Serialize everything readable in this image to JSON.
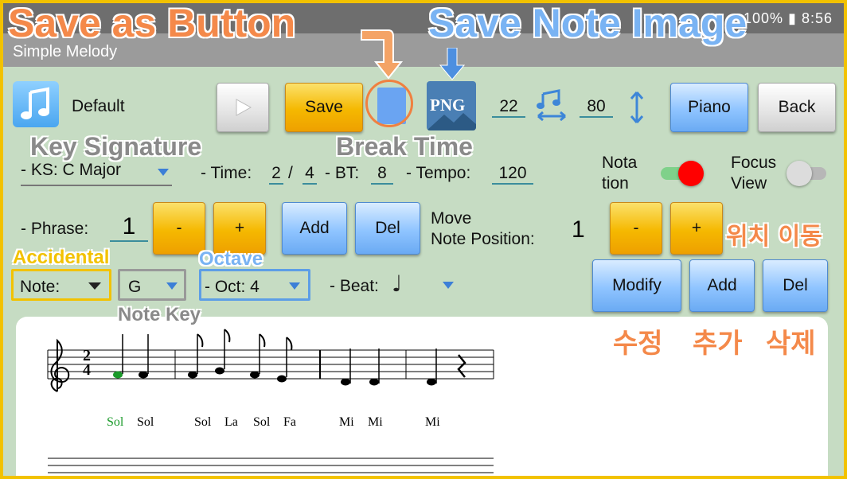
{
  "status_bar": {
    "right_text": "100% ▮ 8:56"
  },
  "app": {
    "title": "Simple Melody"
  },
  "toolbar": {
    "preset_icon": "music-note-icon",
    "preset_label": "Default",
    "play_icon": "play-icon",
    "save_label": "Save",
    "png_label": "PNG",
    "break_value": "22",
    "tempo_icon": "beamed-notes-icon",
    "tempo_value": "80",
    "piano_label": "Piano",
    "back_label": "Back"
  },
  "row2": {
    "ks_value": "- KS: C Major",
    "time_label": "- Time:",
    "time_num": "2",
    "time_sep": "/",
    "time_den": "4",
    "bt_label": "- BT:",
    "bt_value": "8",
    "tempo_label": "- Tempo:",
    "tempo_value": "120",
    "notation_label_1": "Nota",
    "notation_label_2": "tion",
    "focus_label_1": "Focus",
    "focus_label_2": "View"
  },
  "row3": {
    "phrase_label": "- Phrase:",
    "phrase_value": "1",
    "minus_label": "-",
    "plus_label": "+",
    "add_label": "Add",
    "del_label": "Del",
    "move_label_1": "Move",
    "move_label_2": "Note Position:",
    "position_value": "1",
    "pos_minus_label": "-",
    "pos_plus_label": "+"
  },
  "row4": {
    "note_select": "Note:",
    "key_select": "G",
    "octave_select": "- Oct: 4",
    "beat_label": "- Beat:",
    "beat_glyph": "♩",
    "modify_label": "Modify",
    "add_label": "Add",
    "del_label": "Del"
  },
  "annotations": {
    "save_as_button": "Save as Button",
    "save_note_image": "Save Note Image",
    "key_signature": "Key Signature",
    "break_time": "Break Time",
    "accidental": "Accidental",
    "octave": "Octave",
    "note_key": "Note Key",
    "move_position_ko": "위치 이동",
    "modify_ko": "수정",
    "add_ko": "추가",
    "delete_ko": "삭제"
  },
  "score": {
    "time_sig_top": "2",
    "time_sig_bottom": "4",
    "note_names": [
      "Sol",
      "Sol",
      "Sol",
      "La",
      "Sol",
      "Fa",
      "Mi",
      "Mi",
      "Mi"
    ]
  },
  "colors": {
    "frame": "#f2c200",
    "background": "#c6dcc3",
    "annotation_orange": "#f4894a",
    "annotation_blue": "#79b3f3",
    "highlight_note": "#1a9a2a",
    "toggle_on": "#ff0000"
  }
}
